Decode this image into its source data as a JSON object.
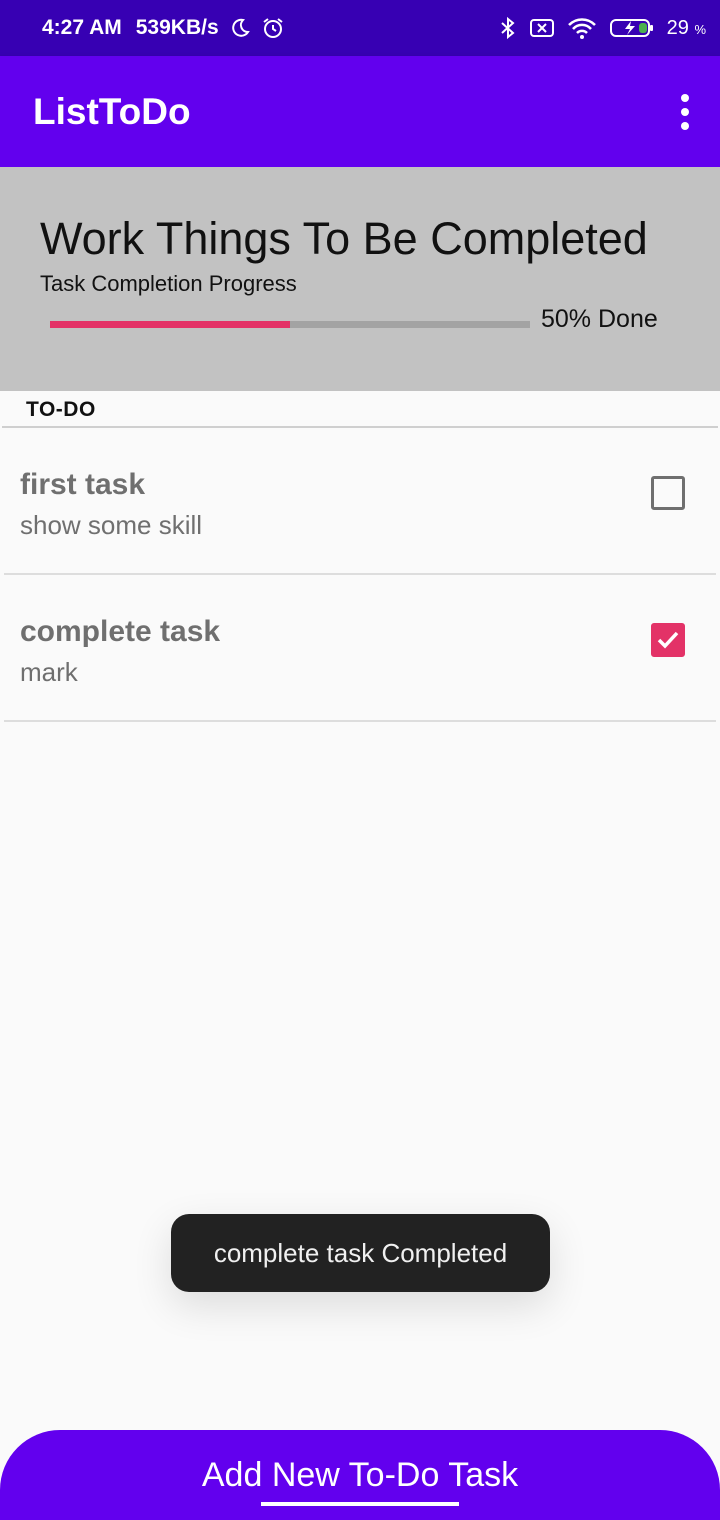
{
  "status_bar": {
    "time": "4:27 AM",
    "network_speed": "539KB/s",
    "battery_percent": "29",
    "battery_unit": "%",
    "icons": [
      "moon-icon",
      "alarm-icon",
      "bluetooth-icon",
      "sim-off-icon",
      "wifi-icon",
      "battery-charging-icon"
    ]
  },
  "app_bar": {
    "title": "ListToDo",
    "menu_icon": "overflow-menu-icon"
  },
  "header": {
    "list_title": "Work Things To Be Completed",
    "progress_label": "Task Completion Progress",
    "progress_fraction": 0.5,
    "progress_text": "50% Done",
    "progress_color": "#e33267"
  },
  "section": {
    "title": "TO-DO"
  },
  "tasks": [
    {
      "title": "first task",
      "description": "show some skill",
      "completed": false
    },
    {
      "title": "complete task",
      "description": "mark",
      "completed": true
    }
  ],
  "toast": {
    "message": "complete task Completed"
  },
  "add_button": {
    "label": "Add New To-Do Task"
  },
  "colors": {
    "primary": "#6200ee",
    "primary_dark": "#3700b3",
    "accent": "#e33267"
  }
}
